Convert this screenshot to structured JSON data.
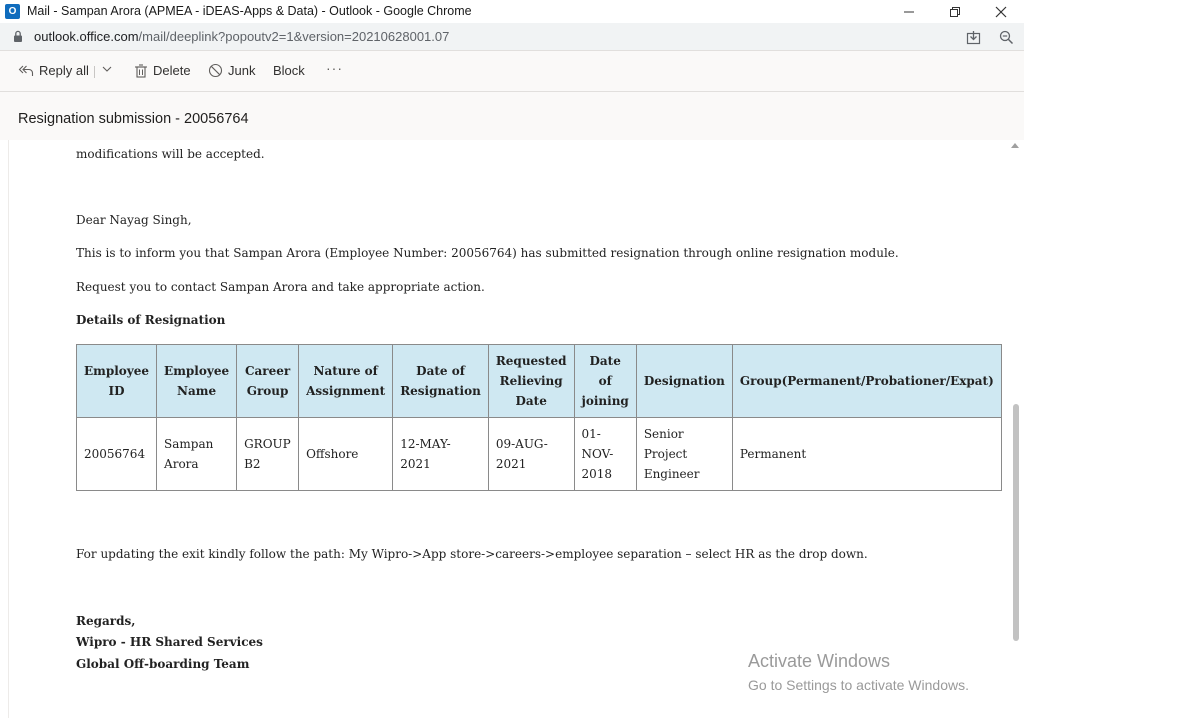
{
  "window": {
    "title": "Mail - Sampan Arora (APMEA - iDEAS-Apps & Data) - Outlook - Google Chrome",
    "app_icon_letter": "O"
  },
  "address_bar": {
    "host": "outlook.office.com",
    "path": "/mail/deeplink?popoutv2=1&version=20210628001.07"
  },
  "toolbar": {
    "reply_all": "Reply all",
    "delete": "Delete",
    "junk": "Junk",
    "block": "Block",
    "more": "···"
  },
  "message": {
    "subject": "Resignation submission - 20056764",
    "partial_line": "modifications will be accepted.",
    "greeting": "Dear Nayag Singh,",
    "para1": "This is to inform you that Sampan Arora (Employee Number: 20056764) has submitted resignation through online resignation module.",
    "para2": "Request you to contact Sampan Arora and take appropriate action.",
    "details_heading": "Details of Resignation",
    "table": {
      "headers": [
        "Employee ID",
        "Employee Name",
        "Career Group",
        "Nature of Assignment",
        "Date of Resignation",
        "Requested Relieving Date",
        "Date of joining",
        "Designation",
        "Group(Permanent/Probationer/Expat)"
      ],
      "row": [
        "20056764",
        "Sampan Arora",
        "GROUP B2",
        "Offshore",
        "12-MAY-2021",
        "09-AUG-2021",
        "01-NOV-2018",
        "Senior Project Engineer",
        "Permanent"
      ]
    },
    "path_line": "For updating the exit kindly follow the path: My Wipro->App store->careers->employee separation – select HR as the drop down.",
    "sign_regards": "Regards,",
    "sign_team1": "Wipro - HR Shared Services",
    "sign_team2": "Global Off-boarding Team"
  },
  "watermark": {
    "title": "Activate Windows",
    "subtitle": "Go to Settings to activate Windows."
  }
}
